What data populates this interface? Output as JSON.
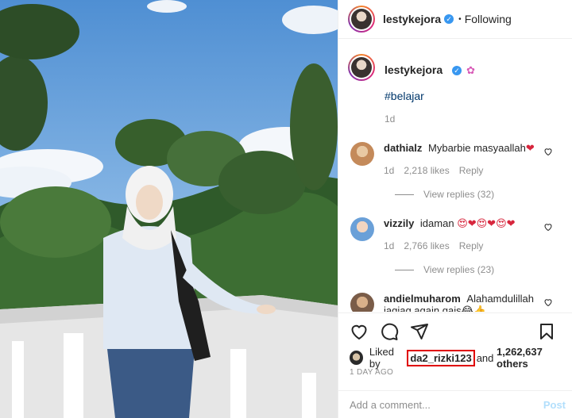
{
  "post": {
    "username": "lestykejora",
    "follow_status": "Following",
    "separator": "•",
    "caption": "#belajar",
    "caption_emoji": "✿",
    "age": "1d"
  },
  "comments": [
    {
      "user": "dathialz",
      "text": "Mybarbie masyaallah",
      "emoji": "❤",
      "age": "1d",
      "likes": "2,218 likes",
      "reply": "Reply",
      "replies": "View replies (32)",
      "avatar_color": "#c48a5a"
    },
    {
      "user": "vizzily",
      "text": "idaman",
      "emoji": "😍❤😍❤😍❤",
      "age": "1d",
      "likes": "2,766 likes",
      "reply": "Reply",
      "replies": "View replies (23)",
      "avatar_color": "#6aa0d8"
    },
    {
      "user": "andielmuharom",
      "text": "Alahamdulillah jagjag again gais",
      "emoji": "😂👍",
      "avatar_color": "#7a5c48"
    }
  ],
  "likes": {
    "prefix": "Liked by",
    "liker": "da2_rizki123",
    "suffix": "and",
    "others": "1,262,637 others"
  },
  "timestamp": "1 DAY AGO",
  "comment_box": {
    "placeholder": "Add a comment...",
    "post_label": "Post"
  },
  "icons": [
    "heart-icon",
    "comment-icon",
    "share-icon",
    "bookmark-icon",
    "verified-badge-icon"
  ],
  "colors": {
    "verified": "#3897f0",
    "link": "#00376b",
    "muted": "#8e8e8e",
    "highlight_box": "#e00000",
    "post_disabled": "#b2dffc"
  }
}
